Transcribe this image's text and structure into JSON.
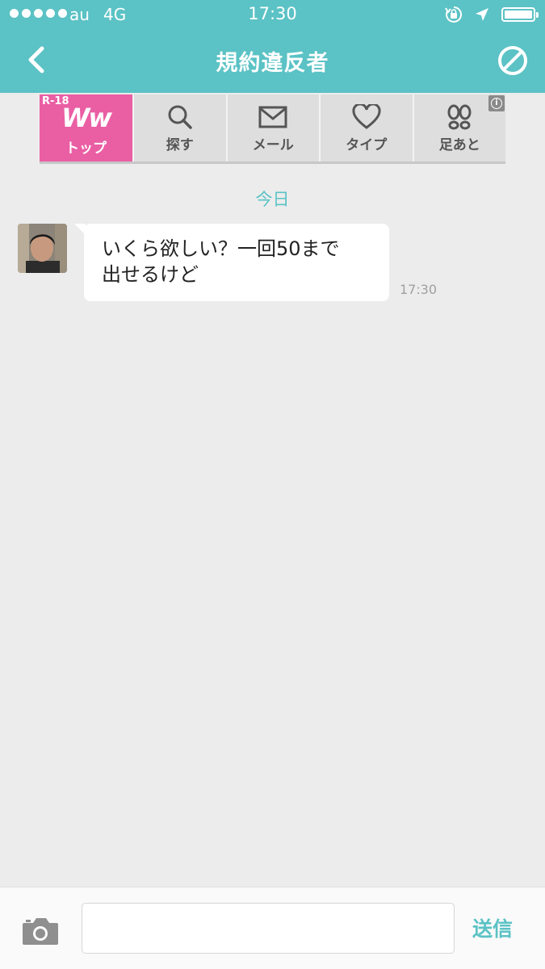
{
  "status_bar": {
    "carrier": "au",
    "network": "4G",
    "time": "17:30",
    "signal_bars": 5,
    "battery_level": 1.0
  },
  "nav": {
    "title": "規約違反者",
    "back_icon": "chevron-left-icon",
    "block_icon": "block-icon"
  },
  "ad": {
    "rating": "R-18",
    "logo": "Ww",
    "top_label": "トップ",
    "tabs": [
      {
        "label": "探す",
        "icon": "search-icon"
      },
      {
        "label": "メール",
        "icon": "mail-icon"
      },
      {
        "label": "タイプ",
        "icon": "heart-icon"
      },
      {
        "label": "足あと",
        "icon": "footprint-icon"
      }
    ],
    "info_icon": "info-icon",
    "info_glyph": "i"
  },
  "chat": {
    "day_label": "今日",
    "messages": [
      {
        "text_line1": "いくら欲しい？一回50まで",
        "text_line2": "出せるけど",
        "time": "17:30"
      }
    ]
  },
  "composer": {
    "placeholder": "",
    "value": "",
    "send_label": "送信",
    "camera_icon": "camera-icon"
  },
  "colors": {
    "accent": "#5bc2c5",
    "ad_pink": "#ea5ea4",
    "background": "#ececec"
  }
}
